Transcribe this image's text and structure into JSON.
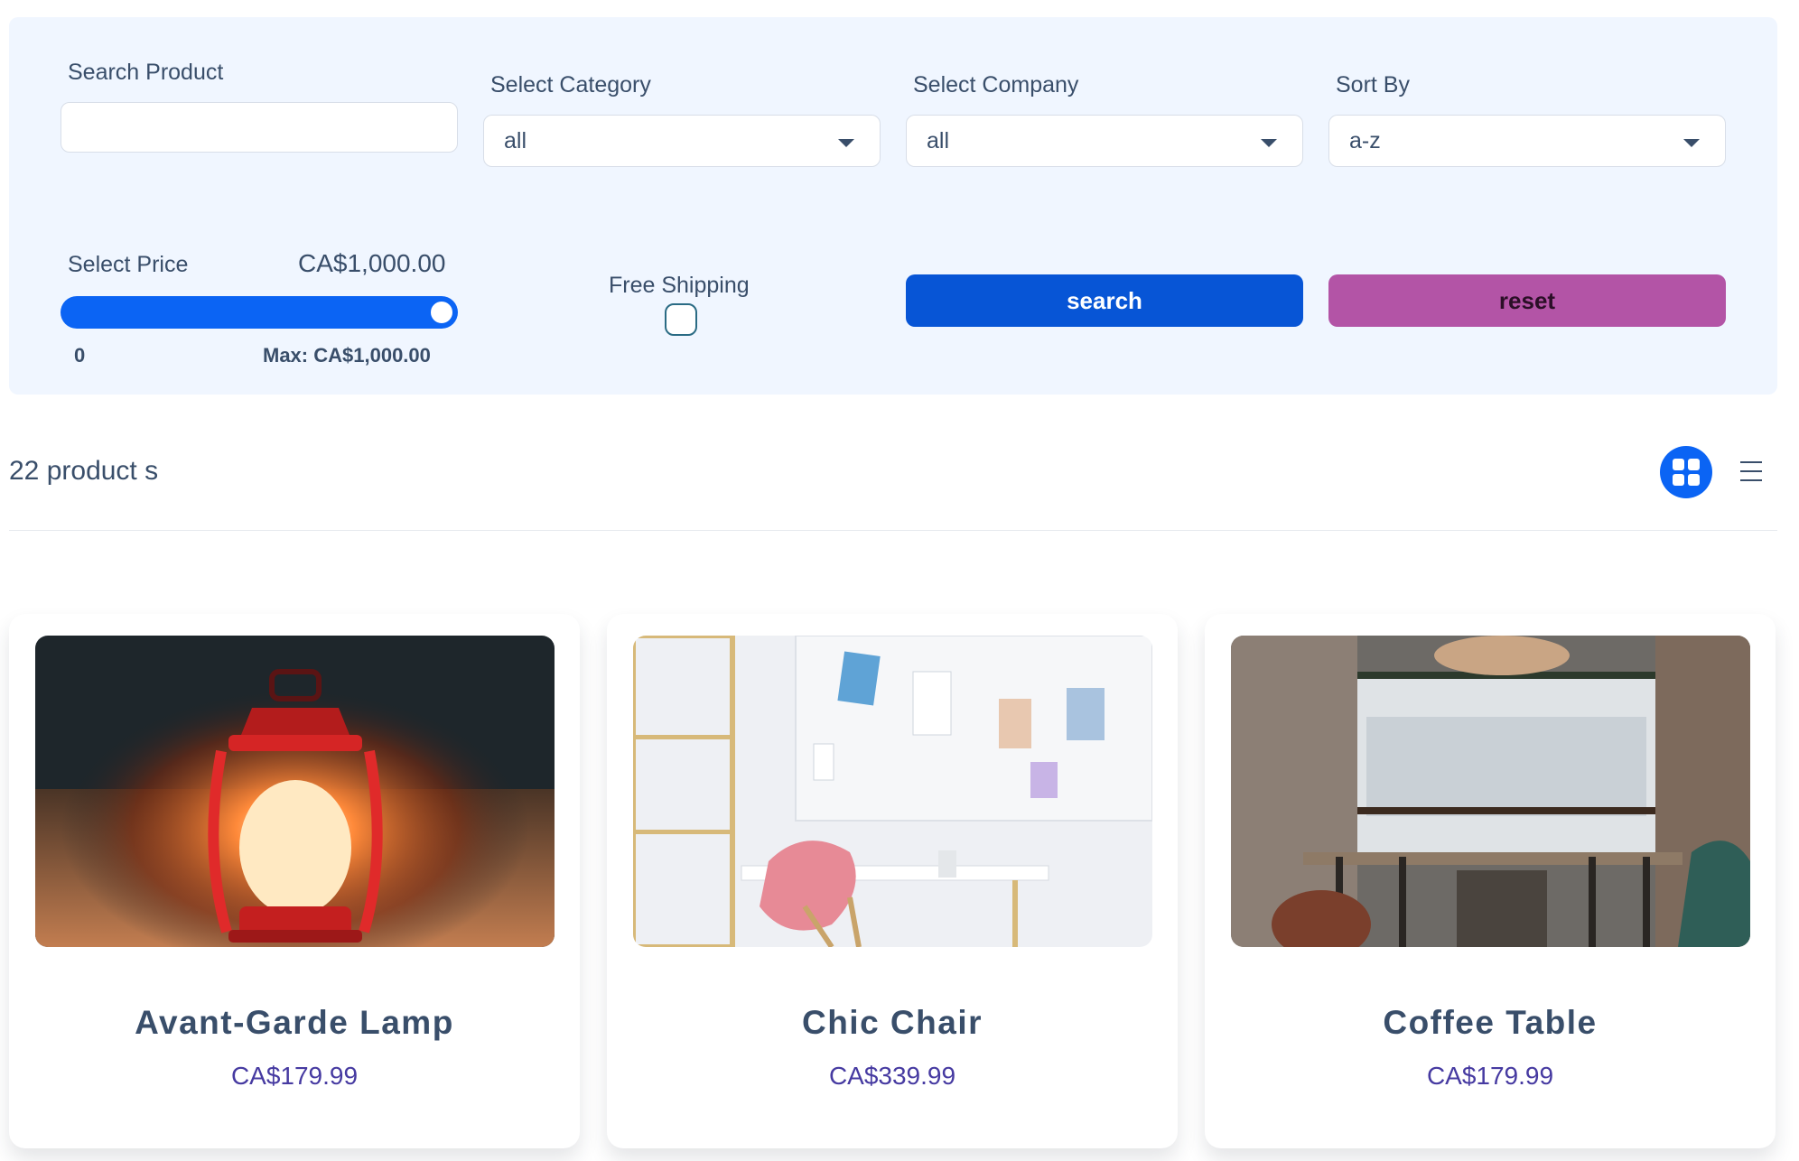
{
  "filters": {
    "search_label": "Search Product",
    "search_value": "",
    "category_label": "Select Category",
    "category_value": "all",
    "company_label": "Select Company",
    "company_value": "all",
    "sort_label": "Sort By",
    "sort_value": "a-z",
    "price_label": "Select Price",
    "price_value": "CA$1,000.00",
    "price_fraction": 1.0,
    "price_min": "0",
    "price_max": "Max: CA$1,000.00",
    "shipping_label": "Free Shipping",
    "shipping_checked": false,
    "search_button": "search",
    "reset_button": "reset"
  },
  "summary": {
    "count_text": "22 product s",
    "view_mode": "grid"
  },
  "products": [
    {
      "title": "Avant-Garde Lamp",
      "price": "CA$179.99",
      "image": "lantern-photo"
    },
    {
      "title": "Chic Chair",
      "price": "CA$339.99",
      "image": "chair-desk-photo"
    },
    {
      "title": "Coffee Table",
      "price": "CA$179.99",
      "image": "cafe-interior-photo"
    }
  ],
  "colors": {
    "primary": "#0b64f4",
    "secondary": "#b354a6",
    "panel": "#f0f6ff",
    "price": "#463aa1",
    "text": "#394e6a"
  }
}
